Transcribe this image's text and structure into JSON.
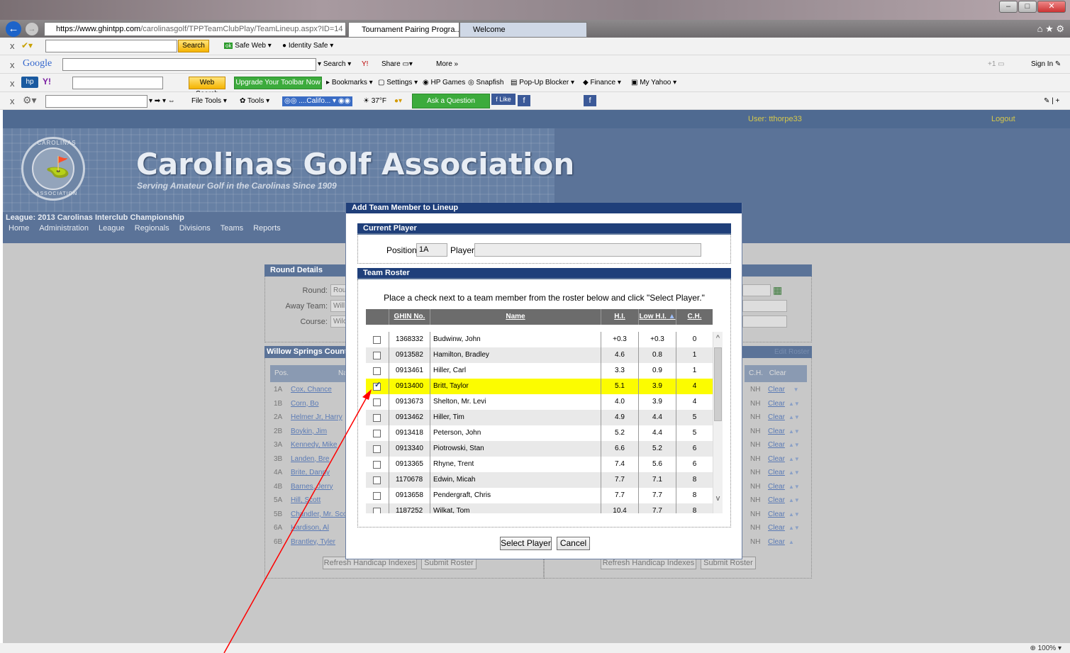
{
  "browser": {
    "url_domain": "https://www.ghintpp.com",
    "url_path": "/carolinasgolf/TPPTeamClubPlay/TeamLineup.aspx?ID=14",
    "tabs": [
      {
        "label": "Tournament Pairing Progra..."
      },
      {
        "label": "Welcome"
      }
    ],
    "search_label": "Search",
    "safe_web": "Safe Web",
    "identity_safe": "Identity Safe",
    "google_label": "Google",
    "search2": "Search",
    "share": "Share",
    "more": "More »",
    "sign_in": "Sign In",
    "web_search": "Web Search",
    "upgrade": "Upgrade Your Toolbar Now",
    "bookmarks": "Bookmarks",
    "settings": "Settings",
    "hp_games": "HP Games",
    "snapfish": "Snapfish",
    "popup_blocker": "Pop-Up Blocker",
    "finance": "Finance",
    "my_yahoo": "My Yahoo",
    "file_tools": "File Tools",
    "tools": "Tools",
    "califo": "....Califo...",
    "temp": "37°F",
    "ask_question": "Ask a Question",
    "fb_like": "Like",
    "zoom": "100%"
  },
  "header": {
    "user": "User: tthorpe33",
    "logout": "Logout",
    "org_title": "Carolinas Golf Association",
    "tagline": "Serving Amateur Golf in the Carolinas Since 1909",
    "seal_top": "CAROLINAS",
    "seal_bottom": "ASSOCIATION",
    "league": "League: 2013 Carolinas Interclub Championship",
    "nav": [
      "Home",
      "Administration",
      "League",
      "Regionals",
      "Divisions",
      "Teams",
      "Reports"
    ]
  },
  "round_details": {
    "title": "Round Details",
    "round_label": "Round:",
    "round_value": "Rou",
    "away_label": "Away Team:",
    "away_value": "Will",
    "course_label": "Course:",
    "course_value": "Wilc"
  },
  "team_panel": {
    "title": "Willow Springs Countr",
    "col_pos": "Pos.",
    "col_name": "Na",
    "col_ch": "C.H.",
    "col_clear": "Clear",
    "edit_roster": "Edit Roster",
    "rows": [
      {
        "pos": "1A",
        "name": "Cox, Chance"
      },
      {
        "pos": "1B",
        "name": "Corn, Bo"
      },
      {
        "pos": "2A",
        "name": "Helmer Jr, Harry"
      },
      {
        "pos": "2B",
        "name": "Boykin, Jim"
      },
      {
        "pos": "3A",
        "name": "Kennedy, Mike"
      },
      {
        "pos": "3B",
        "name": "Landen, Bre"
      },
      {
        "pos": "4A",
        "name": "Brite, Danny"
      },
      {
        "pos": "4B",
        "name": "Barnes, Jerry"
      },
      {
        "pos": "5A",
        "name": "Hill, Scott"
      },
      {
        "pos": "5B",
        "name": "Chandler, Mr. Sco"
      },
      {
        "pos": "6A",
        "name": "Hardison, Al"
      },
      {
        "pos": "6B",
        "name": "Brantley, Tyler"
      }
    ],
    "nh": "NH",
    "clear": "Clear",
    "refresh_btn": "Refresh Handicap Indexes",
    "submit_btn": "Submit Roster"
  },
  "modal": {
    "title": "Add Team Member to Lineup",
    "current_player_head": "Current Player",
    "position_label": "Position:",
    "position_value": "1A",
    "player_label": "Player:",
    "player_value": "",
    "roster_head": "Team Roster",
    "instructions": "Place a check next to a team member from the roster below and click \"Select Player.\"",
    "columns": {
      "ghin": "GHIN No.",
      "name": "Name",
      "hi": "H.I.",
      "low_hi": "Low H.I.",
      "ch": "C.H."
    },
    "rows": [
      {
        "checked": false,
        "ghin": "1368332",
        "name": "Budwinw, John",
        "hi": "+0.3",
        "low": "+0.3",
        "ch": "0"
      },
      {
        "checked": false,
        "ghin": "0913582",
        "name": "Hamilton, Bradley",
        "hi": "4.6",
        "low": "0.8",
        "ch": "1"
      },
      {
        "checked": false,
        "ghin": "0913461",
        "name": "Hiller, Carl",
        "hi": "3.3",
        "low": "0.9",
        "ch": "1"
      },
      {
        "checked": true,
        "ghin": "0913400",
        "name": "Britt, Taylor",
        "hi": "5.1",
        "low": "3.9",
        "ch": "4"
      },
      {
        "checked": false,
        "ghin": "0913673",
        "name": "Shelton, Mr. Levi",
        "hi": "4.0",
        "low": "3.9",
        "ch": "4"
      },
      {
        "checked": false,
        "ghin": "0913462",
        "name": "Hiller, Tim",
        "hi": "4.9",
        "low": "4.4",
        "ch": "5"
      },
      {
        "checked": false,
        "ghin": "0913418",
        "name": "Peterson, John",
        "hi": "5.2",
        "low": "4.4",
        "ch": "5"
      },
      {
        "checked": false,
        "ghin": "0913340",
        "name": "Piotrowski, Stan",
        "hi": "6.6",
        "low": "5.2",
        "ch": "6"
      },
      {
        "checked": false,
        "ghin": "0913365",
        "name": "Rhyne, Trent",
        "hi": "7.4",
        "low": "5.6",
        "ch": "6"
      },
      {
        "checked": false,
        "ghin": "1170678",
        "name": "Edwin, Micah",
        "hi": "7.7",
        "low": "7.1",
        "ch": "8"
      },
      {
        "checked": false,
        "ghin": "0913658",
        "name": "Pendergraft, Chris",
        "hi": "7.7",
        "low": "7.7",
        "ch": "8"
      },
      {
        "checked": false,
        "ghin": "1187252",
        "name": "Wilkat, Tom",
        "hi": "10.4",
        "low": "7.7",
        "ch": "8"
      }
    ],
    "select_btn": "Select Player",
    "cancel_btn": "Cancel"
  },
  "colors": {
    "accent_dark": "#1f3f7a",
    "banner": "#5b7398",
    "selected_row": "#fcfc00",
    "annotation": "#ff0000"
  }
}
